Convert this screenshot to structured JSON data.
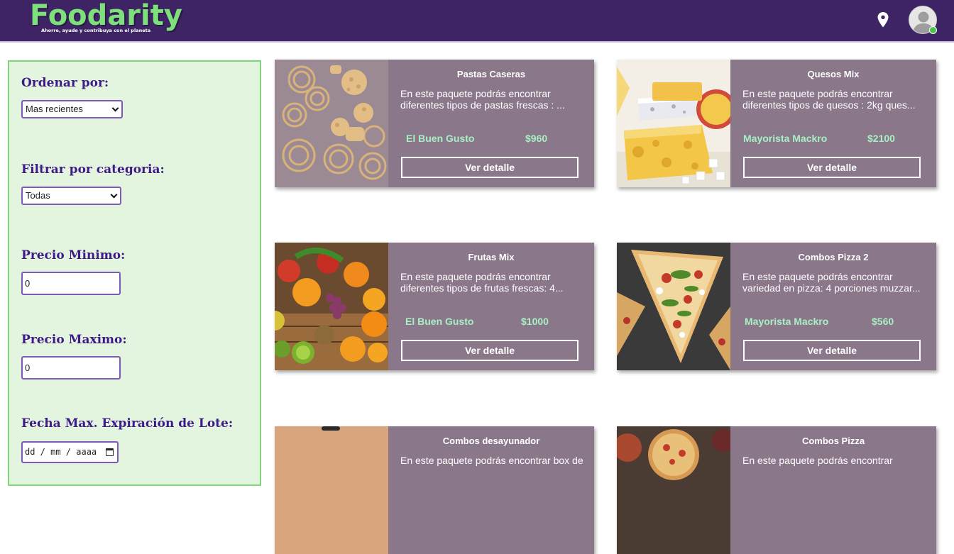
{
  "header": {
    "logo_title": "Foodarity",
    "logo_tagline": "Ahorre, ayude y contribuya con el planeta",
    "location_icon": "location-pin-icon",
    "avatar_icon": "user-avatar-icon",
    "status_color": "#4cc34c"
  },
  "filters": {
    "sort_label": "Ordenar por:",
    "sort_value": "Mas recientes",
    "category_label": "Filtrar por categoria:",
    "category_value": "Todas",
    "min_price_label": "Precio Minimo:",
    "min_price_value": "0",
    "max_price_label": "Precio Maximo:",
    "max_price_value": "0",
    "expiry_label": "Fecha Max. Expiración de Lote:",
    "expiry_placeholder": "dd / mm / aaaa"
  },
  "cards": [
    {
      "title": "Pastas Caseras",
      "description": "En este paquete podrás encontrar diferentes tipos de pastas frescas : ...",
      "vendor": "El Buen Gusto",
      "price": "$960",
      "button": "Ver detalle",
      "image": "pasta-image"
    },
    {
      "title": "Quesos Mix",
      "description": "En este paquete podrás encontrar diferentes tipos de quesos : 2kg ques...",
      "vendor": "Mayorista Mackro",
      "price": "$2100",
      "button": "Ver detalle",
      "image": "cheese-image"
    },
    {
      "title": "Frutas Mix",
      "description": "En este paquete podrás encontrar diferentes tipos de frutas frescas: 4...",
      "vendor": "El Buen Gusto",
      "price": "$1000",
      "button": "Ver detalle",
      "image": "fruits-image"
    },
    {
      "title": "Combos Pizza 2",
      "description": "En este paquete podrás encontrar variedad en pizza: 4 porciones muzzar...",
      "vendor": "Mayorista Mackro",
      "price": "$560",
      "button": "Ver detalle",
      "image": "pizza-image"
    },
    {
      "title": "Combos desayunador",
      "description": "En este paquete podrás encontrar box de",
      "vendor": "",
      "price": "",
      "button": "",
      "image": "breakfast-box-image"
    },
    {
      "title": "Combos Pizza",
      "description": "En este paquete podrás encontrar",
      "vendor": "",
      "price": "",
      "button": "",
      "image": "pizzas-image"
    }
  ],
  "colors": {
    "header_bg": "#3f2465",
    "logo_green": "#7ee07a",
    "sidebar_bg": "#e3f5df",
    "sidebar_border": "#7ed67b",
    "filter_label": "#3f1b87",
    "card_bg": "#8a7789",
    "card_accent": "#a8f0c4"
  }
}
